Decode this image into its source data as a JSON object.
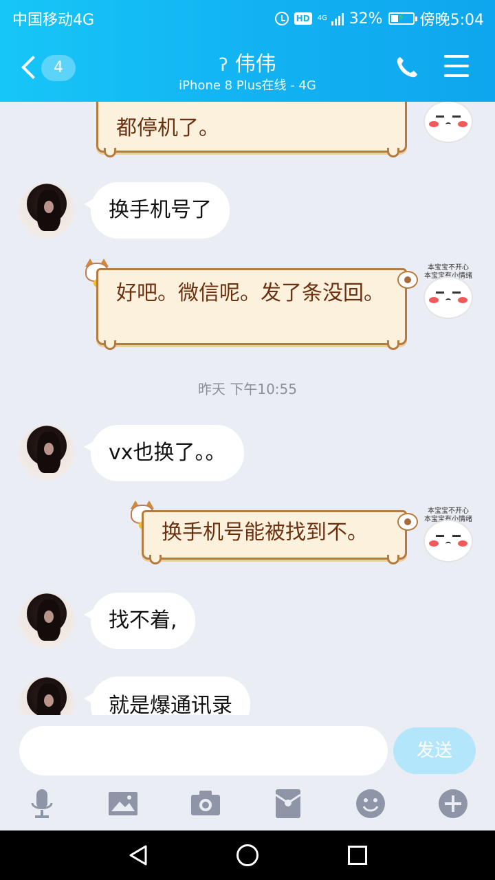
{
  "status_bar": {
    "carrier": "中国移动4G",
    "hd_label": "HD",
    "net_label": "4G",
    "battery_percent": "32%",
    "time": "傍晚5:04"
  },
  "header": {
    "unread_count": "4",
    "contact_name": "伟伟",
    "online_status": "iPhone 8 Plus在线 - 4G"
  },
  "messages": [
    {
      "from": "me",
      "style": "scroll",
      "text": "都停机了。"
    },
    {
      "from": "other",
      "text": "换手机号了"
    },
    {
      "from": "me",
      "style": "scroll",
      "text": "好吧。微信呢。发了条没回。"
    },
    {
      "from": "other",
      "text": "vx也换了。。"
    },
    {
      "from": "me",
      "style": "scroll",
      "text": "换手机号能被找到不。"
    },
    {
      "from": "other",
      "text": "找不着,"
    },
    {
      "from": "other",
      "text": "就是爆通讯录"
    }
  ],
  "timestamp": "昨天 下午10:55",
  "sticker_caption": {
    "line1": "本宝宝不开心",
    "line2": "本宝宝有小情绪"
  },
  "input": {
    "placeholder": "",
    "send_label": "发送"
  },
  "colors": {
    "header_accent": "#12b3f2",
    "chat_bg": "#eaedf4",
    "send_disabled": "#b4e6fb"
  }
}
